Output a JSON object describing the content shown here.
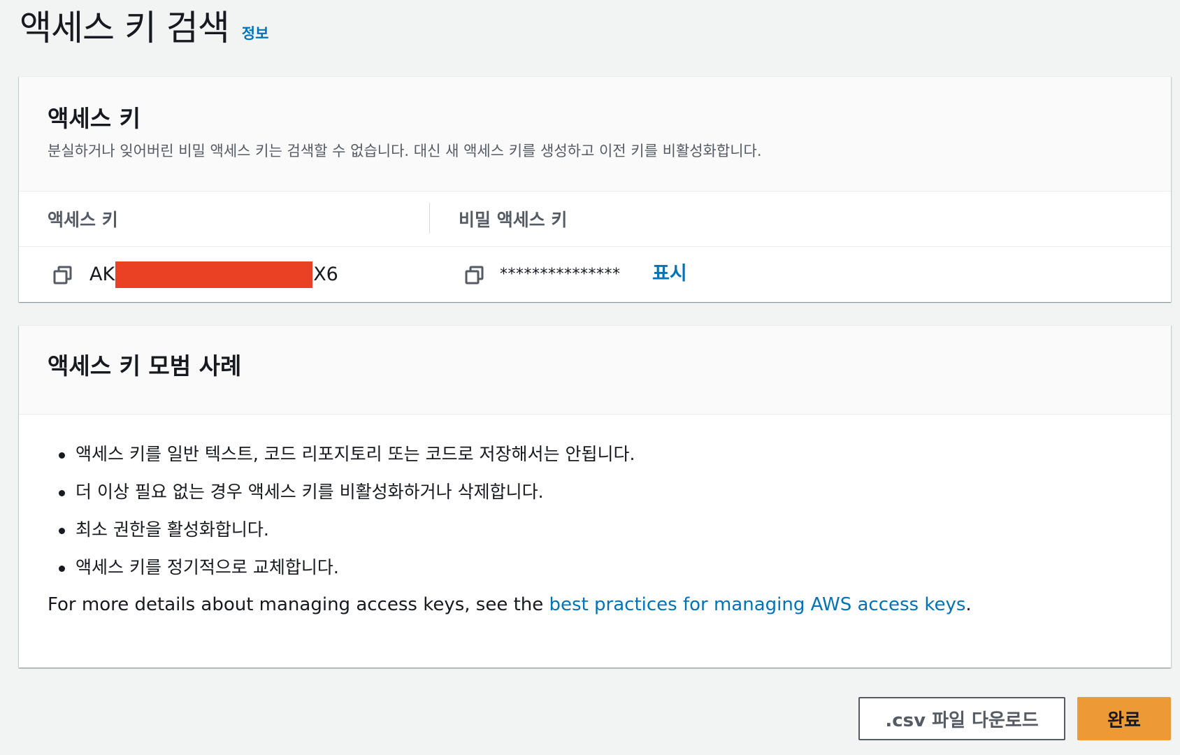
{
  "header": {
    "title": "액세스 키 검색",
    "info_link": "정보"
  },
  "keys_panel": {
    "title": "액세스 키",
    "description": "분실하거나 잊어버린 비밀 액세스 키는 검색할 수 없습니다. 대신 새 액세스 키를 생성하고 이전 키를 비활성화합니다.",
    "columns": {
      "access_key": "액세스 키",
      "secret_key": "비밀 액세스 키"
    },
    "access_key_prefix": "AK",
    "access_key_suffix": "X6",
    "redaction_color": "#ea4125",
    "secret_key_masked": "***************",
    "show_link": "표시"
  },
  "best_practices": {
    "title": "액세스 키 모범 사례",
    "items": [
      "액세스 키를 일반 텍스트, 코드 리포지토리 또는 코드로 저장해서는 안됩니다.",
      "더 이상 필요 없는 경우 액세스 키를 비활성화하거나 삭제합니다.",
      "최소 권한을 활성화합니다.",
      "액세스 키를 정기적으로 교체합니다."
    ],
    "footer_text": "For more details about managing access keys, see the ",
    "footer_link": "best practices for managing AWS access keys",
    "footer_end": "."
  },
  "actions": {
    "csv_download": ".csv 파일 다운로드",
    "done": "완료"
  },
  "colors": {
    "link": "#0073bb",
    "primary_button": "#ec9a35",
    "background": "#f2f3f3"
  },
  "icons": {
    "copy": "copy-icon"
  }
}
